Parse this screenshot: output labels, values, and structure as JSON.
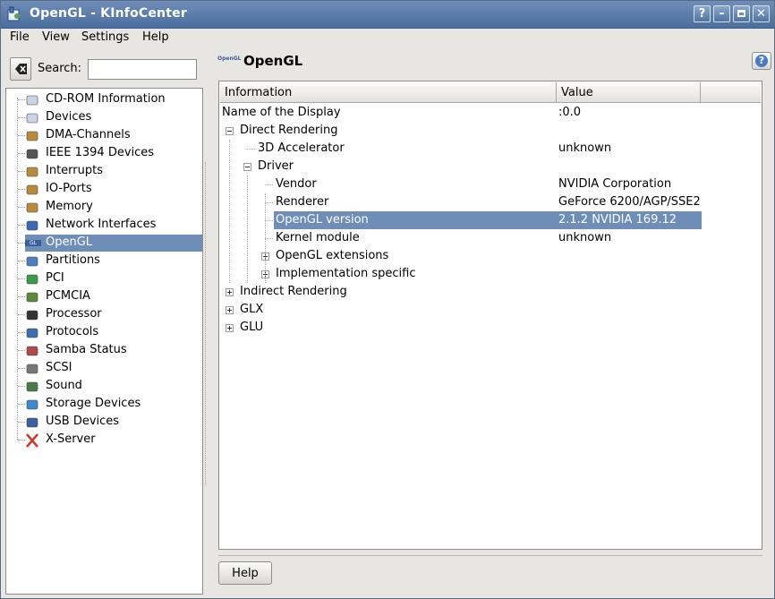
{
  "window": {
    "title": "OpenGL - KInfoCenter"
  },
  "menubar": {
    "items": [
      "File",
      "View",
      "Settings",
      "Help"
    ]
  },
  "search": {
    "label": "Search:",
    "value": ""
  },
  "sidebar": {
    "items": [
      {
        "label": "CD-ROM Information",
        "icon": "cdrom-icon"
      },
      {
        "label": "Devices",
        "icon": "devices-icon"
      },
      {
        "label": "DMA-Channels",
        "icon": "chip-icon"
      },
      {
        "label": "IEEE 1394 Devices",
        "icon": "firewire-icon"
      },
      {
        "label": "Interrupts",
        "icon": "chip-icon"
      },
      {
        "label": "IO-Ports",
        "icon": "chip-icon"
      },
      {
        "label": "Memory",
        "icon": "chip-icon"
      },
      {
        "label": "Network Interfaces",
        "icon": "network-icon"
      },
      {
        "label": "OpenGL",
        "icon": "opengl-icon"
      },
      {
        "label": "Partitions",
        "icon": "partitions-icon"
      },
      {
        "label": "PCI",
        "icon": "pci-icon"
      },
      {
        "label": "PCMCIA",
        "icon": "pcmcia-icon"
      },
      {
        "label": "Processor",
        "icon": "processor-icon"
      },
      {
        "label": "Protocols",
        "icon": "protocols-icon"
      },
      {
        "label": "Samba Status",
        "icon": "samba-icon"
      },
      {
        "label": "SCSI",
        "icon": "scsi-icon"
      },
      {
        "label": "Sound",
        "icon": "sound-icon"
      },
      {
        "label": "Storage Devices",
        "icon": "storage-icon"
      },
      {
        "label": "USB Devices",
        "icon": "usb-icon"
      },
      {
        "label": "X-Server",
        "icon": "xserver-icon"
      }
    ],
    "selected": "OpenGL"
  },
  "page": {
    "title": "OpenGL",
    "title_icon_text": "OpenGL"
  },
  "table": {
    "columns": [
      "Information",
      "Value"
    ],
    "rows": [
      {
        "key": "Name of the Display",
        "value": ":0.0"
      },
      {
        "key": "Direct Rendering",
        "value": ""
      },
      {
        "key": "3D Accelerator",
        "value": "unknown"
      },
      {
        "key": "Driver",
        "value": ""
      },
      {
        "key": "Vendor",
        "value": "NVIDIA Corporation"
      },
      {
        "key": "Renderer",
        "value": "GeForce 6200/AGP/SSE2"
      },
      {
        "key": "OpenGL version",
        "value": "2.1.2 NVIDIA 169.12"
      },
      {
        "key": "Kernel module",
        "value": "unknown"
      },
      {
        "key": "OpenGL extensions",
        "value": ""
      },
      {
        "key": "Implementation specific",
        "value": ""
      },
      {
        "key": "Indirect Rendering",
        "value": ""
      },
      {
        "key": "GLX",
        "value": ""
      },
      {
        "key": "GLU",
        "value": ""
      }
    ],
    "selected_row": "OpenGL version"
  },
  "footer": {
    "help_label": "Help"
  },
  "colors": {
    "titlebar": "#5a7dab",
    "selection": "#6e8db7",
    "background": "#e8e6e3"
  }
}
